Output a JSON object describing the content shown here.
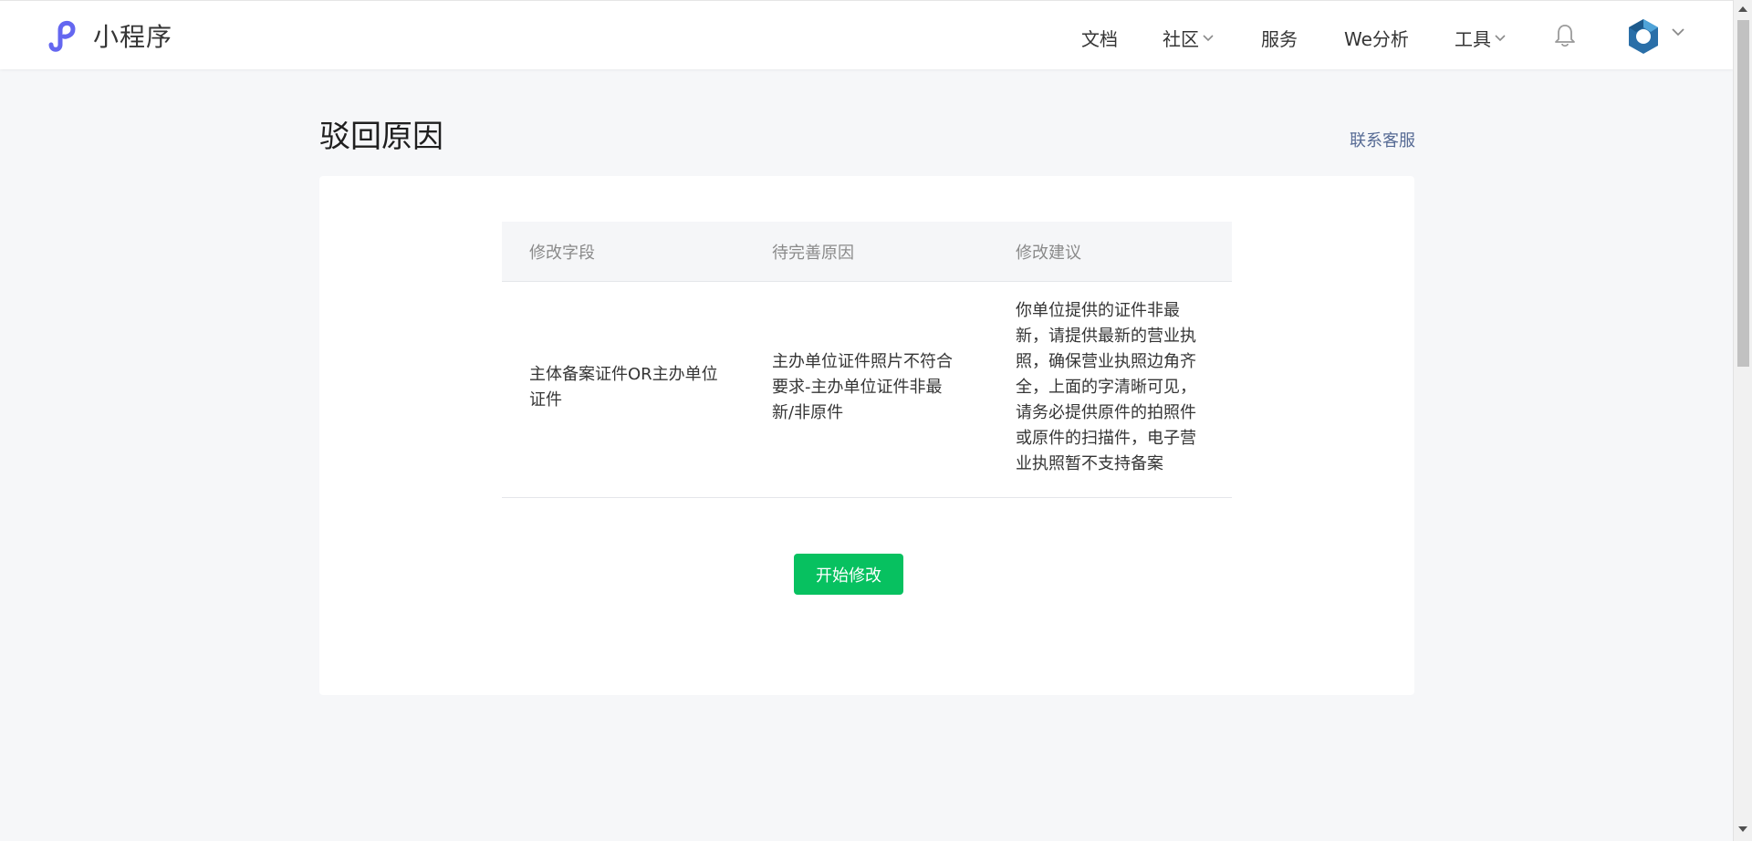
{
  "header": {
    "logo_text": "小程序",
    "nav": [
      {
        "label": "文档",
        "has_dropdown": false
      },
      {
        "label": "社区",
        "has_dropdown": true
      },
      {
        "label": "服务",
        "has_dropdown": false
      },
      {
        "label": "We分析",
        "has_dropdown": false
      },
      {
        "label": "工具",
        "has_dropdown": true
      }
    ],
    "icons": [
      "notification-bell-icon",
      "avatar-logo-icon",
      "chevron-down-icon"
    ]
  },
  "page": {
    "title": "驳回原因",
    "contact_link": "联系客服"
  },
  "table": {
    "headers": [
      "修改字段",
      "待完善原因",
      "修改建议"
    ],
    "rows": [
      {
        "field": "主体备案证件OR主办单位证件",
        "reason": "主办单位证件照片不符合要求-主办单位证件非最新/非原件",
        "suggestion": "你单位提供的证件非最新，请提供最新的营业执照，确保营业执照边角齐全，上面的字清晰可见，请务必提供原件的拍照件或原件的扫描件，电子营业执照暂不支持备案"
      }
    ]
  },
  "action": {
    "start_edit_label": "开始修改"
  },
  "colors": {
    "brand_green": "#07c160",
    "link_blue": "#576b95",
    "logo_purple": "#6467f0"
  }
}
